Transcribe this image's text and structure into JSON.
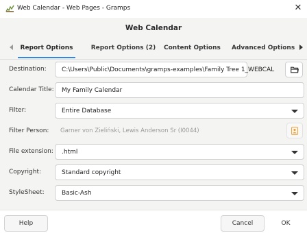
{
  "window": {
    "title": "Web Calendar - Web Pages - Gramps"
  },
  "dialog": {
    "title": "Web Calendar"
  },
  "tabs": [
    {
      "label": "Report Options",
      "active": true
    },
    {
      "label": "Report Options (2)",
      "active": false
    },
    {
      "label": "Content Options",
      "active": false
    },
    {
      "label": "Advanced Options",
      "active": false
    }
  ],
  "form": {
    "destination": {
      "label": "Destination:",
      "value": "C:\\Users\\Public\\Documents\\gramps-examples\\Family Tree 1_WEBCAL"
    },
    "calendar_title": {
      "label": "Calendar Title:",
      "value": "My Family Calendar"
    },
    "filter": {
      "label": "Filter:",
      "value": "Entire Database"
    },
    "filter_person": {
      "label": "Filter Person:",
      "value": "Garner von Zieliński, Lewis Anderson Sr (I0044)"
    },
    "file_extension": {
      "label": "File extension:",
      "value": ".html"
    },
    "copyright": {
      "label": "Copyright:",
      "value": "Standard copyright"
    },
    "stylesheet": {
      "label": "StyleSheet:",
      "value": "Basic-Ash"
    }
  },
  "buttons": {
    "help": "Help",
    "cancel": "Cancel",
    "ok": "OK"
  },
  "icons": {
    "app": "gramps-app-icon",
    "folder": "folder-open-icon",
    "person": "person-select-icon",
    "close": "close-icon"
  },
  "colors": {
    "accent": "#3584e4",
    "person_icon": "#e8a13c"
  }
}
